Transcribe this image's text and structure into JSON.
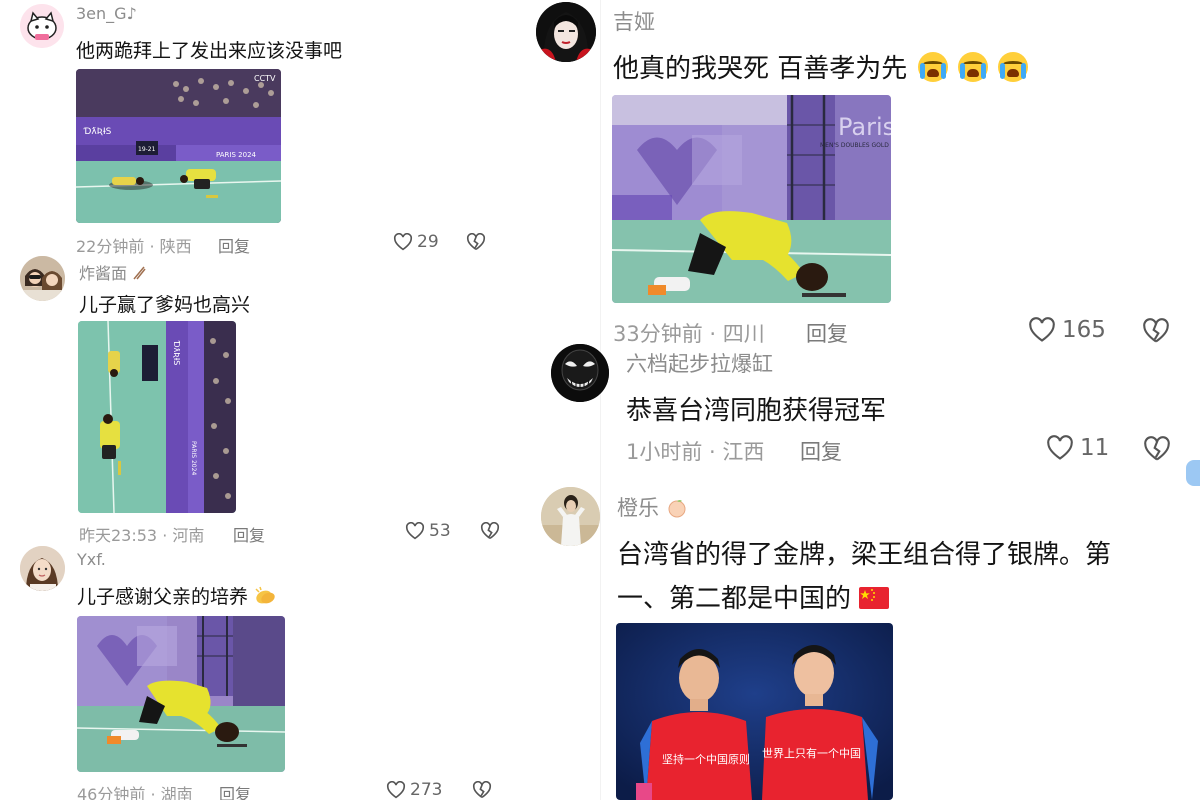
{
  "left_comments": [
    {
      "username": "3en_G♪",
      "text": "他两跪拜上了发出来应该没事吧",
      "time": "22分钟前",
      "location": "陕西",
      "reply": "回复",
      "likes": "29"
    },
    {
      "username": "炸酱面",
      "text": "儿子赢了爹妈也高兴",
      "time": "昨天23:53",
      "location": "河南",
      "reply": "回复",
      "likes": "53"
    },
    {
      "username": "Yxf.",
      "text": "儿子感谢父亲的培养",
      "time": "46分钟前",
      "location": "湖南",
      "reply": "回复",
      "likes": "273"
    }
  ],
  "right_comments": [
    {
      "username": "吉娅",
      "text": "他真的我哭死 百善孝为先",
      "time": "33分钟前",
      "location": "四川",
      "reply": "回复",
      "likes": "165"
    },
    {
      "username": "六档起步拉爆缸",
      "text": "恭喜台湾同胞获得冠军",
      "time": "1小时前",
      "location": "江西",
      "reply": "回复",
      "likes": "11"
    },
    {
      "username": "橙乐",
      "text_line1": "台湾省的得了金牌，梁王组合得了银牌。第",
      "text_line2": "一、第二都是中国的"
    }
  ],
  "image_text": {
    "broadcaster": "CCTV",
    "paris_logo": "PARIS 2024",
    "paris_banner": "Paris",
    "score": "19-21",
    "event": "MEN'S DOUBLES GOLD",
    "caption_left": "坚持一个中国原则",
    "caption_right": "世界上只有一个中国"
  },
  "colors": {
    "court_purple": "#5b3fa6",
    "court_green": "#6fb8a2",
    "jersey_yellow": "#e9e53a",
    "jersey_red": "#e8232f",
    "accent_blue": "#9cc8f3"
  }
}
